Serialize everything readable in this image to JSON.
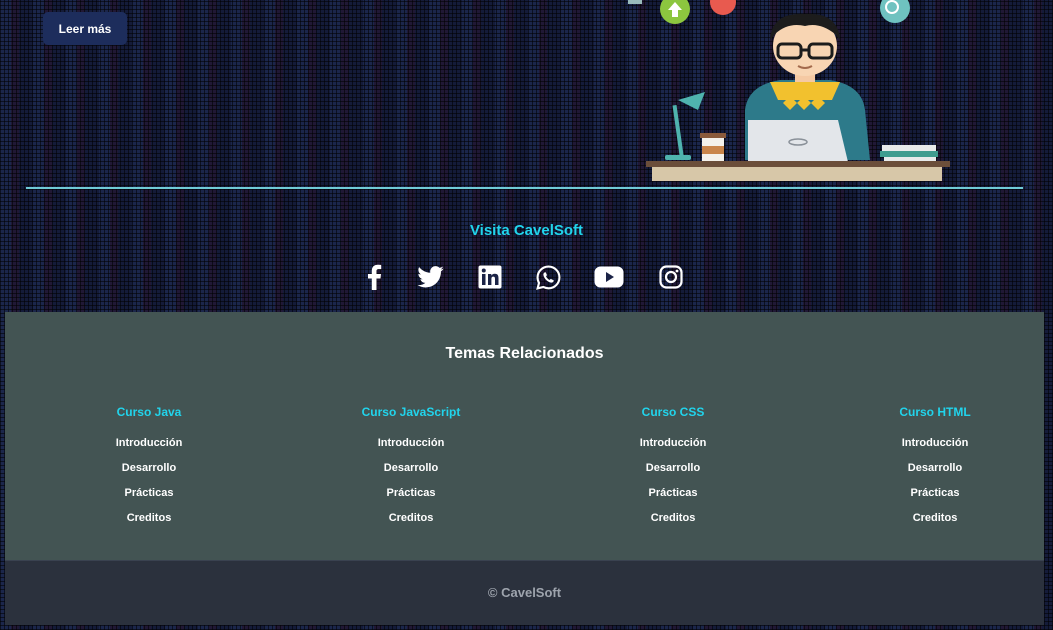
{
  "hero": {
    "read_more_label": "Leer más"
  },
  "social": {
    "heading": "Visita CavelSoft",
    "icons": [
      "facebook-icon",
      "twitter-icon",
      "linkedin-icon",
      "whatsapp-icon",
      "youtube-icon",
      "instagram-icon"
    ],
    "icon_color": "#ffffff"
  },
  "related": {
    "title": "Temas Relacionados",
    "columns": [
      {
        "title": "Curso Java",
        "links": [
          "Introducción",
          "Desarrollo",
          "Prácticas",
          "Creditos"
        ]
      },
      {
        "title": "Curso JavaScript",
        "links": [
          "Introducción",
          "Desarrollo",
          "Prácticas",
          "Creditos"
        ]
      },
      {
        "title": "Curso CSS",
        "links": [
          "Introducción",
          "Desarrollo",
          "Prácticas",
          "Creditos"
        ]
      },
      {
        "title": "Curso HTML",
        "links": [
          "Introducción",
          "Desarrollo",
          "Prácticas",
          "Creditos"
        ]
      }
    ]
  },
  "footer": {
    "copyright": "© CavelSoft"
  },
  "colors": {
    "accent": "#21d4ec",
    "footer_bg": "#435453",
    "bottom_bg": "#2b313d",
    "button_bg": "#1d2d5c"
  }
}
